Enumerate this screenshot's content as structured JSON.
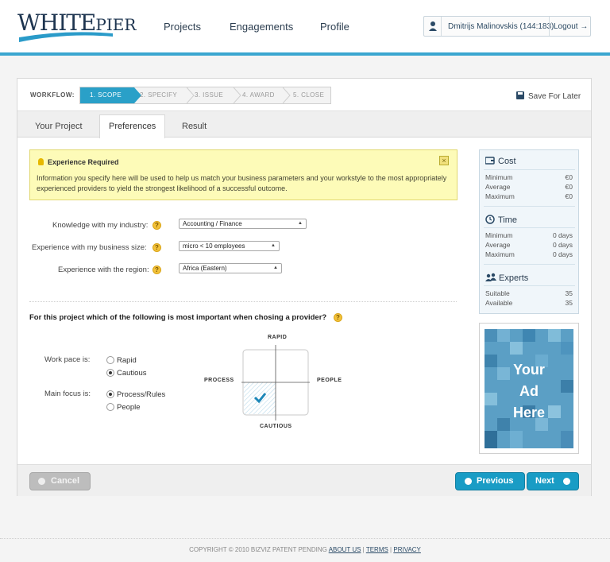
{
  "header": {
    "logo": "WHITEPIER",
    "nav": [
      "Projects",
      "Engagements",
      "Profile"
    ],
    "user_name": "Dmitrijs Malinovskis (144:183)",
    "logout_label": "Logout →"
  },
  "workflow": {
    "label": "WORKFLOW:",
    "steps": [
      "1. SCOPE",
      "2. SPECIFY",
      "3. ISSUE",
      "4. AWARD",
      "5. CLOSE"
    ],
    "active_step": 0,
    "save_label": "Save For Later"
  },
  "tabs": [
    "Your Project",
    "Preferences",
    "Result"
  ],
  "active_tab": 1,
  "alert": {
    "title": "Experience Required",
    "text": "Information you specify here will be used to help us match your business parameters and your workstyle to the most appropriately experienced  providers to yield the strongest likelihood of a successful outcome."
  },
  "form": {
    "industry_label": "Knowledge with my industry:",
    "industry_value": "Accounting / Finance",
    "size_label": "Experience with my business size:",
    "size_value": "micro < 10 employees",
    "region_label": "Experience with the region:",
    "region_value": "Africa (Eastern)"
  },
  "question": "For this project which of the following is most important when chosing a provider?",
  "work_pace": {
    "label": "Work pace is:",
    "options": [
      "Rapid",
      "Cautious"
    ],
    "selected": 1
  },
  "main_focus": {
    "label": "Main focus is:",
    "options": [
      "Process/Rules",
      "People"
    ],
    "selected": 0
  },
  "matrix": {
    "top": "RAPID",
    "bottom": "CAUTIOUS",
    "left": "PROCESS",
    "right": "PEOPLE"
  },
  "stats": {
    "cost": {
      "title": "Cost",
      "rows": [
        [
          "Minimum",
          "€0"
        ],
        [
          "Average",
          "€0"
        ],
        [
          "Maximum",
          "€0"
        ]
      ]
    },
    "time": {
      "title": "Time",
      "rows": [
        [
          "Minimum",
          "0 days"
        ],
        [
          "Average",
          "0 days"
        ],
        [
          "Maximum",
          "0 days"
        ]
      ]
    },
    "experts": {
      "title": "Experts",
      "rows": [
        [
          "Suitable",
          "35"
        ],
        [
          "Available",
          "35"
        ]
      ]
    }
  },
  "ad": {
    "line1": "Your",
    "line2": "Ad",
    "line3": "Here"
  },
  "buttons": {
    "cancel": "Cancel",
    "previous": "Previous",
    "next": "Next"
  },
  "footer": {
    "copyright": "COPYRIGHT © 2010 BIZVIZ PATENT PENDING",
    "about": "ABOUT US",
    "terms": "TERMS",
    "privacy": "PRIVACY"
  },
  "colors": {
    "accent": "#2aa0c8",
    "brand_dark": "#1e3550",
    "alert_bg": "#fdfbb8"
  }
}
